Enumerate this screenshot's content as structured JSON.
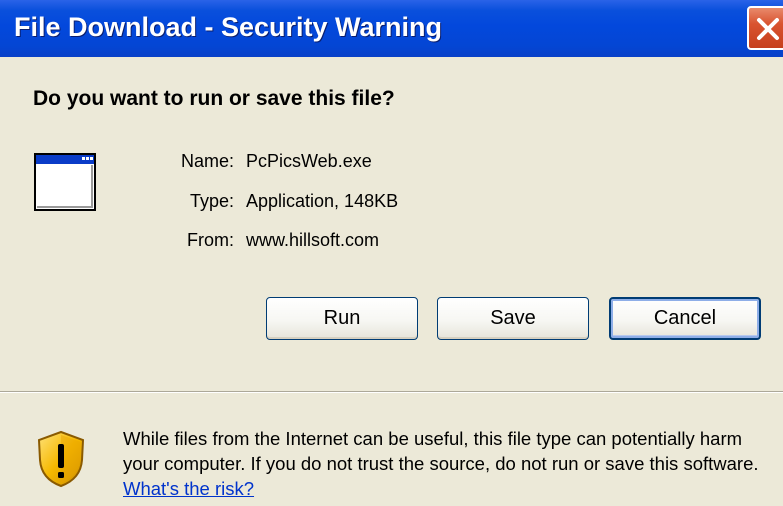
{
  "window": {
    "title": "File Download - Security Warning"
  },
  "dialog": {
    "question": "Do you want to run or save this file?",
    "file_icon": "application-window-icon",
    "info": [
      {
        "label": "Name:",
        "value": "PcPicsWeb.exe"
      },
      {
        "label": "Type:",
        "value": "Application, 148KB"
      },
      {
        "label": "From:",
        "value": "www.hillsoft.com"
      }
    ],
    "buttons": {
      "run": "Run",
      "save": "Save",
      "cancel": "Cancel"
    },
    "warning": {
      "icon": "shield-warning-icon",
      "text": "While files from the Internet can be useful, this file type can potentially harm your computer. If you do not trust the source, do not run or save this software.",
      "link": "What's the risk?"
    }
  },
  "colors": {
    "titlebar": "#0348dc",
    "dialog_bg": "#ece9d8",
    "close_button": "#d9532f",
    "link": "#0033cc"
  }
}
